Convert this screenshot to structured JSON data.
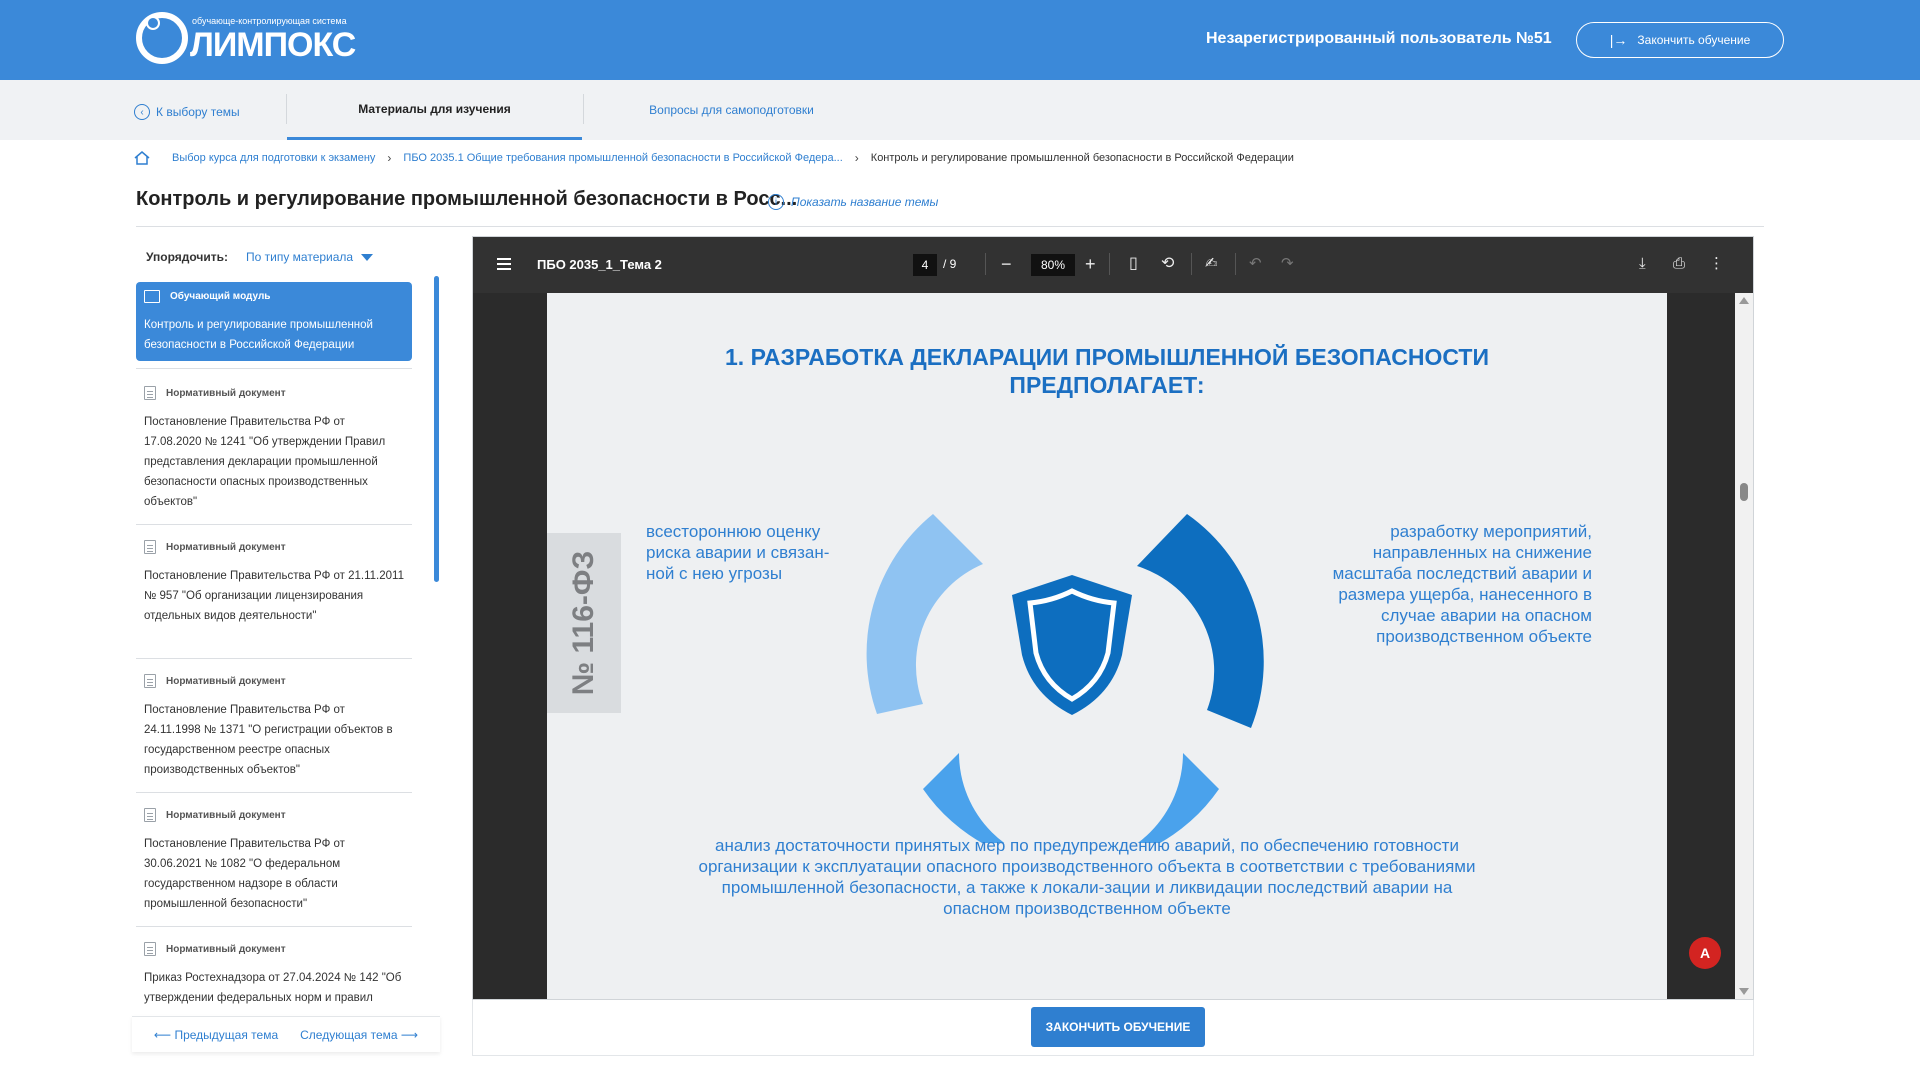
{
  "header": {
    "logo_subtitle": "обучающе-контролирующая система",
    "logo_name": "ЛИМПОКС",
    "user_name": "Незарегистрированный пользователь №51",
    "finish_label": "Закончить обучение"
  },
  "tabs": {
    "back_label": "К выбору темы",
    "items": [
      {
        "label": "Материалы для изучения",
        "active": true
      },
      {
        "label": "Вопросы для самоподготовки",
        "active": false
      }
    ]
  },
  "breadcrumb": {
    "items": [
      "Выбор курса для подготовки к экзамену",
      "ПБО 2035.1 Общие требования промышленной безопасности в Российской Федера..."
    ],
    "current": "Контроль и регулирование промышленной безопасности в Российской Федерации"
  },
  "page": {
    "title": "Контроль и регулирование промышленной безопасности в Росс...",
    "show_name_label": "Показать название темы"
  },
  "sidebar": {
    "sort_label": "Упорядочить:",
    "sort_value": "По типу материала",
    "items": [
      {
        "type": "Обучающий модуль",
        "text": "Контроль и регулирование промышленной безопасности в Российской Федерации",
        "active": true
      },
      {
        "type": "Нормативный документ",
        "text": "Постановление Правительства РФ от 17.08.2020 № 1241 \"Об утверждении Правил представления декларации промышленной безопасности опасных производственных объектов\"",
        "active": false
      },
      {
        "type": "Нормативный документ",
        "text": "Постановление Правительства РФ от 21.11.2011 № 957 \"Об организации лицензирования отдельных видов деятельности\"",
        "active": false
      },
      {
        "type": "Нормативный документ",
        "text": "Постановление Правительства РФ от 24.11.1998 № 1371 \"О регистрации объектов в государственном реестре опасных производственных объектов\"",
        "active": false
      },
      {
        "type": "Нормативный документ",
        "text": "Постановление Правительства РФ от 30.06.2021 № 1082 \"О федеральном государственном надзоре в области промышленной безопасности\"",
        "active": false
      },
      {
        "type": "Нормативный документ",
        "text": "Приказ Ростехнадзора от 27.04.2024 № 142 \"Об утверждении федеральных норм и правил",
        "active": false
      }
    ],
    "prev_label": "Предыдущая тема",
    "next_label": "Следующая тема"
  },
  "viewer": {
    "file_name": "ПБО 2035_1_Тема 2",
    "current_page": "4",
    "total_pages": "/ 9",
    "zoom": "80%"
  },
  "slide": {
    "title_line1": "1. РАЗРАБОТКА ДЕКЛАРАЦИИ ПРОМЫШЛЕННОЙ БЕЗОПАСНОСТИ",
    "title_line2": "ПРЕДПОЛАГАЕТ:",
    "law_label": "№ 116-ФЗ",
    "left_text": "всестороннюю оценку риска аварии и связан-ной с нею угрозы",
    "right_text": "разработку мероприятий, направленных на снижение масштаба последствий аварии и размера ущерба, нанесенного в случае аварии на опасном производственном объекте",
    "bottom_text": "анализ достаточности принятых мер по предупреждению аварий, по обеспечению готовности организации к эксплуатации опасного производственного объекта в соответствии с требованиями промышленной безопасности, а также к локали-зации и ликвидации последствий аварии на опасном производственном объекте",
    "colors": {
      "light": "#8fc3f2",
      "mid": "#4aa2ec",
      "dark": "#0d6ebf"
    }
  },
  "footer": {
    "finish_button": "ЗАКОНЧИТЬ ОБУЧЕНИЕ"
  }
}
